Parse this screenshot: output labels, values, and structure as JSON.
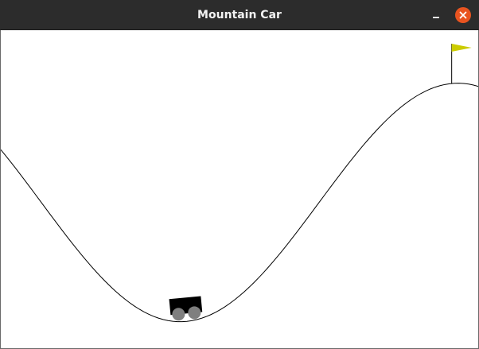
{
  "window": {
    "title": "Mountain Car"
  },
  "icons": {
    "minimize": "minimize-icon",
    "close": "close-icon"
  },
  "colors": {
    "titlebar": "#2c2c2c",
    "title_text": "#f2f2f2",
    "close_button": "#e95420",
    "background": "#ffffff",
    "track": "#000000",
    "car_body": "#000000",
    "wheel": "#7f7f7f",
    "flag": "#cccc00",
    "flagpole": "#000000"
  },
  "environment": {
    "min_position": -1.2,
    "max_position": 0.6,
    "goal_position": 0.5,
    "car_position": -0.5
  }
}
